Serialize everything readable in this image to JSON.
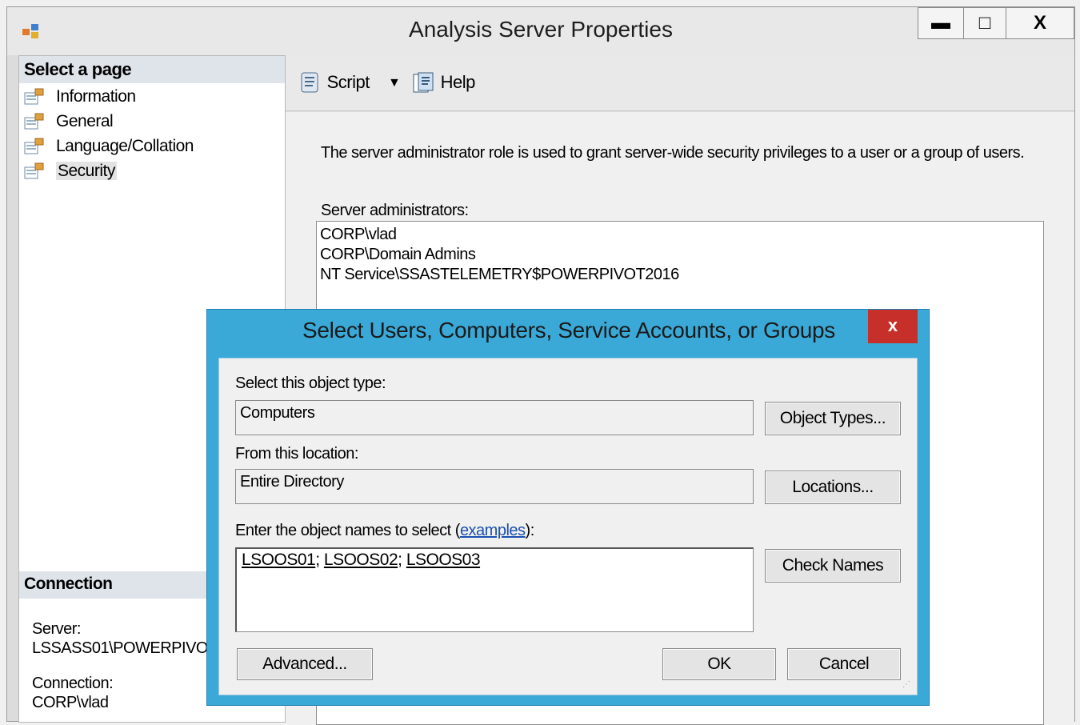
{
  "window": {
    "title": "Analysis Server Properties",
    "minimize": "▬",
    "maximize": "□",
    "close": "X"
  },
  "sidebar": {
    "header": "Select a page",
    "items": [
      {
        "label": "Information"
      },
      {
        "label": "General"
      },
      {
        "label": "Language/Collation"
      },
      {
        "label": "Security",
        "selected": true
      }
    ],
    "connection": {
      "header": "Connection",
      "server_label": "Server:",
      "server_value": "LSSASS01\\POWERPIVOT2016",
      "connection_label": "Connection:",
      "connection_value": "CORP\\vlad"
    }
  },
  "toolbar": {
    "script_label": "Script",
    "help_label": "Help"
  },
  "security": {
    "description": "The server administrator role is used to grant server-wide security privileges to a user or a group of users.",
    "admins_label": "Server administrators:",
    "admins": [
      "CORP\\vlad",
      "CORP\\Domain Admins",
      "NT Service\\SSASTELEMETRY$POWERPIVOT2016"
    ]
  },
  "dialog": {
    "title": "Select Users, Computers, Service Accounts, or Groups",
    "close": "x",
    "object_type_label": "Select this object type:",
    "object_type_value": "Computers",
    "object_types_button": "Object Types...",
    "location_label": "From this location:",
    "location_value": "Entire Directory",
    "locations_button": "Locations...",
    "names_label_prefix": "Enter the object names to select (",
    "names_label_link": "examples",
    "names_label_suffix": "):",
    "names": [
      "LSOOS01",
      "LSOOS02",
      "LSOOS03"
    ],
    "separator": "; ",
    "check_names_button": "Check Names",
    "advanced_button": "Advanced...",
    "ok_button": "OK",
    "cancel_button": "Cancel"
  },
  "icons": {
    "app": "server-properties-icon",
    "page": "page-icon",
    "script": "script-icon",
    "help": "help-icon"
  }
}
